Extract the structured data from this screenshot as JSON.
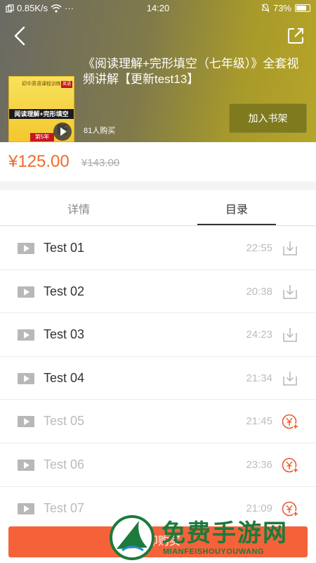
{
  "status_bar": {
    "network_speed": "0.85K/s",
    "dots": "···",
    "time": "14:20",
    "battery": "73%"
  },
  "course": {
    "title": "《阅读理解+完形填空（七年级）》全套视频讲解【更新test13】",
    "buyers": "81人购买",
    "shelf_button": "加入书架",
    "cover_top": "初中英语课程训练",
    "cover_main": "阅读理解+完形填空",
    "cover_new": "新",
    "cover_tag": "第5年",
    "cover_badge": "英语"
  },
  "price": {
    "current": "¥125.00",
    "original": "¥143.00",
    "accent_color": "#f06a2c"
  },
  "tabs": [
    {
      "label": "详情",
      "active": false
    },
    {
      "label": "目录",
      "active": true
    }
  ],
  "lessons": [
    {
      "name": "Test 01",
      "duration": "22:55",
      "action": "download-icon",
      "locked": false
    },
    {
      "name": "Test 02",
      "duration": "20:38",
      "action": "download-icon",
      "locked": false
    },
    {
      "name": "Test 03",
      "duration": "24:23",
      "action": "download-icon",
      "locked": false
    },
    {
      "name": "Test 04",
      "duration": "21:34",
      "action": "download-icon",
      "locked": false
    },
    {
      "name": "Test 05",
      "duration": "21:45",
      "action": "paid-icon",
      "locked": true
    },
    {
      "name": "Test 06",
      "duration": "23:36",
      "action": "paid-icon",
      "locked": true
    },
    {
      "name": "Test 07",
      "duration": "21:09",
      "action": "paid-icon",
      "locked": true
    }
  ],
  "bottom": {
    "buy_button": "立即购买",
    "button_color": "#f5623a"
  },
  "watermark": {
    "text": "免费手游网",
    "sub": "MIANFEISHOUYOUWANG"
  }
}
